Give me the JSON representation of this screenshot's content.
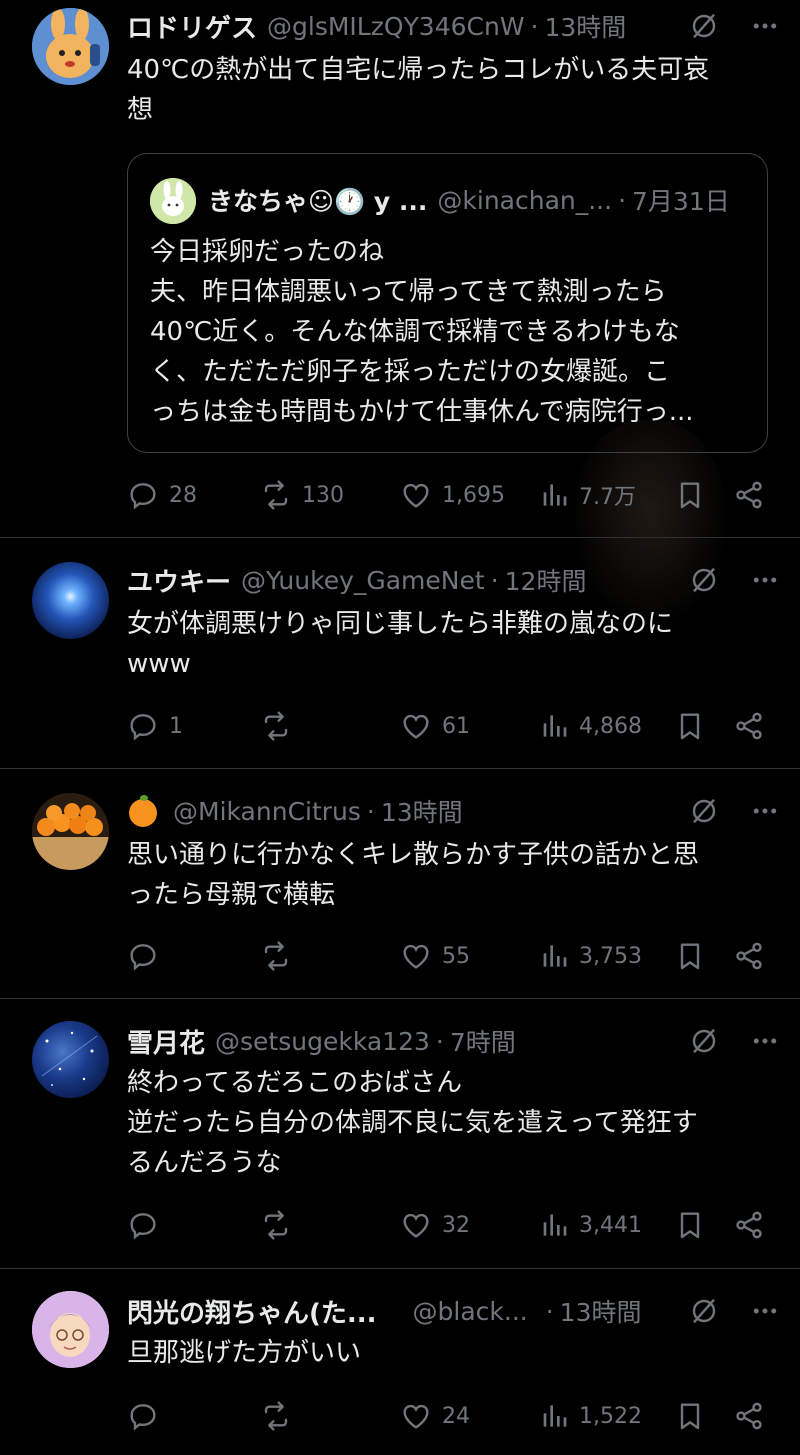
{
  "tweets": [
    {
      "name": "ロドリゲス",
      "handle": "@glsMILzQY346CnW",
      "sep": "·",
      "time": "13時間",
      "text": "40℃の熱が出て自宅に帰ったらコレがいる夫可哀\n想",
      "quote": {
        "name": "きなちゃ☺🕐 y ...",
        "handle": "@kinachan_...",
        "sep": "·",
        "time": "7月31日",
        "text": "今日採卵だったのね\n夫、昨日体調悪いって帰ってきて熱測ったら\n40℃近く。そんな体調で採精できるわけもな\nく、ただただ卵子を採っただけの女爆誕。こ\nっちは金も時間もかけて仕事休んで病院行っ..."
      },
      "replies": "28",
      "retweets": "130",
      "likes": "1,695",
      "views": "7.7万"
    },
    {
      "name": "ユウキー",
      "handle": "@Yuukey_GameNet",
      "sep": "·",
      "time": "12時間",
      "text": "女が体調悪けりゃ同じ事したら非難の嵐なのに\nwww",
      "replies": "1",
      "retweets": "",
      "likes": "61",
      "views": "4,868"
    },
    {
      "name": "",
      "handle": "@MikannCitrus",
      "sep": "·",
      "time": "13時間",
      "text": "思い通りに行かなくキレ散らかす子供の話かと思\nったら母親で横転",
      "replies": "",
      "retweets": "",
      "likes": "55",
      "views": "3,753"
    },
    {
      "name": "雪月花",
      "handle": "@setsugekka123",
      "sep": "·",
      "time": "7時間",
      "text": "終わってるだろこのおばさん\n逆だったら自分の体調不良に気を遣えって発狂す\nるんだろうな",
      "replies": "",
      "retweets": "",
      "likes": "32",
      "views": "3,441"
    },
    {
      "name": "閃光の翔ちゃん(た...",
      "handle": "@black...",
      "sep": "·",
      "time": "13時間",
      "text": "旦那逃げた方がいい",
      "replies": "",
      "retweets": "",
      "likes": "24",
      "views": "1,522"
    }
  ],
  "icons": {
    "more": "more-dots-icon",
    "grok": "grok-slash-icon",
    "reply": "reply-icon",
    "retweet": "retweet-icon",
    "like": "heart-icon",
    "views": "views-bars-icon",
    "bookmark": "bookmark-icon",
    "share": "share-icon"
  },
  "colors": {
    "background": "#000000",
    "text": "#e7e9ea",
    "secondary": "#71767b",
    "divider": "#2f3336"
  }
}
